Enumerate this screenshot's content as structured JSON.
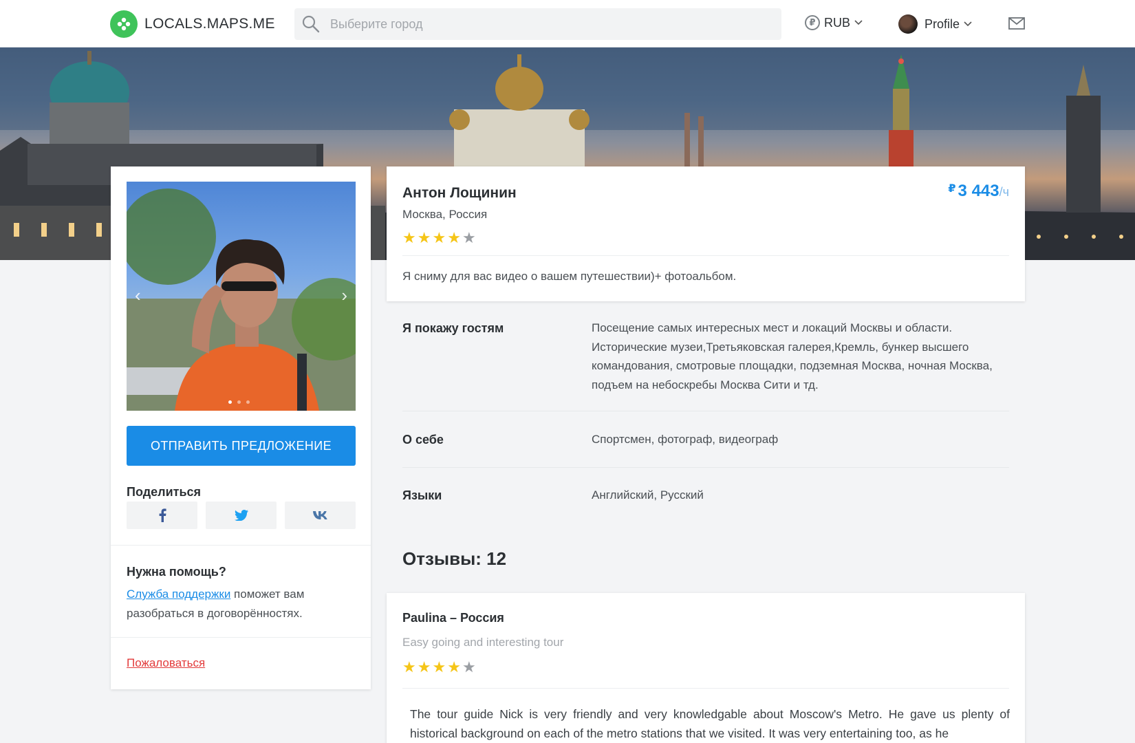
{
  "header": {
    "logo_text": "LOCALS.MAPS.ME",
    "search_placeholder": "Выберите город",
    "currency_symbol": "₽",
    "currency": "RUB",
    "profile_label": "Profile"
  },
  "left_panel": {
    "cta_label": "Отправить предложение",
    "share_title": "Поделиться",
    "share": {
      "facebook": "f",
      "twitter": "twitter",
      "vk": "vk"
    },
    "help_title": "Нужна помощь?",
    "help_link": "Служба поддержки",
    "help_text": " поможет вам разобраться в договорённостях.",
    "report_label": "Пожаловаться"
  },
  "guide": {
    "name": "Антон Лощинин",
    "location": "Москва, Россия",
    "rating": 4,
    "price_currency": "₽",
    "price_value": "3 443",
    "price_unit": "/ч",
    "tagline": "Я сниму для вас видео о вашем путешествии)+ фотоальбом."
  },
  "details": [
    {
      "label": "Я покажу гостям",
      "value": "Посещение самых интересных мест и локаций Москвы и области. Исторические музеи,Третьяковская галерея,Кремль,  бункер высшего командования, смотровые площадки, подземная Москва, ночная Москва, подъем на небоскребы Москва Сити и тд."
    },
    {
      "label": "О себе",
      "value": "Спортсмен, фотограф, видеограф"
    },
    {
      "label": "Языки",
      "value": "Английский, Русский"
    }
  ],
  "reviews": {
    "title": "Отзывы: 12",
    "items": [
      {
        "author": "Paulina – Россия",
        "title": "Easy going and interesting tour",
        "rating": 4,
        "body": "The tour guide Nick is very friendly and very knowledgable about Moscow's Metro. He gave us plenty of historical background on each of the metro stations that we visited. It was very entertaining too, as he"
      }
    ]
  },
  "colors": {
    "accent": "#1a8ce6",
    "star": "#f5c518",
    "star_empty": "#9a9ea3",
    "brand_green": "#3fc35a",
    "danger": "#e23a3a"
  }
}
